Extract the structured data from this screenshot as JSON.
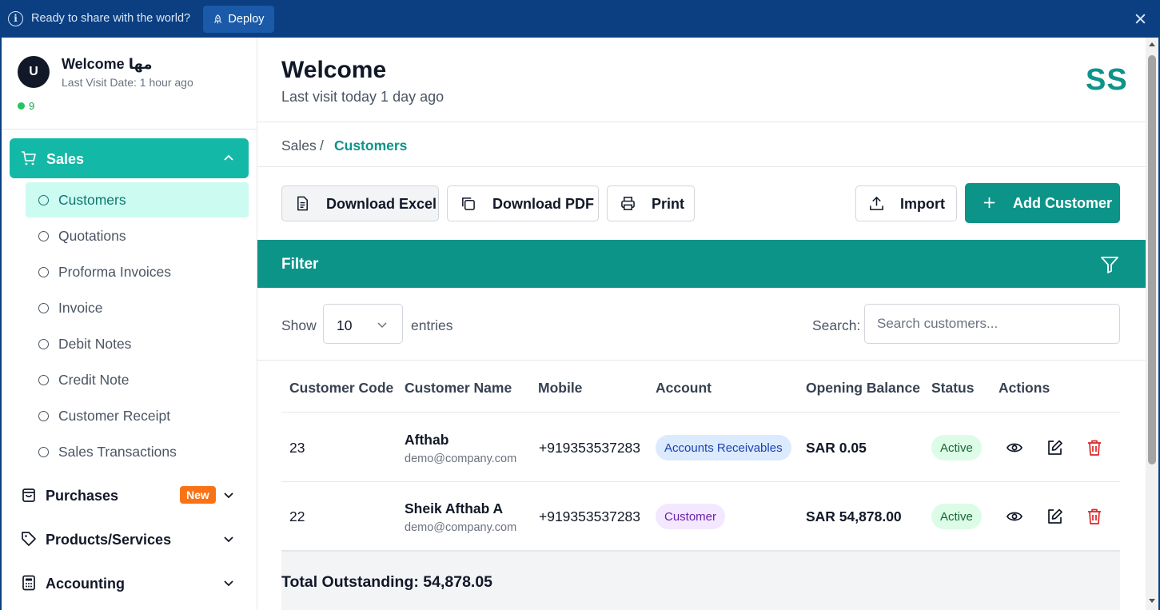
{
  "banner": {
    "message": "Ready to share with the world?",
    "deploy_label": "Deploy",
    "color": "#0b3f82"
  },
  "user": {
    "initial": "U",
    "welcome": "Welcome مها",
    "last_visit": "Last Visit Date: 1 hour ago",
    "online_count": "9"
  },
  "sidebar": {
    "sales_label": "Sales",
    "sales_items": [
      {
        "label": "Customers",
        "active": true
      },
      {
        "label": "Quotations"
      },
      {
        "label": "Proforma Invoices"
      },
      {
        "label": "Invoice"
      },
      {
        "label": "Debit Notes"
      },
      {
        "label": "Credit Note"
      },
      {
        "label": "Customer Receipt"
      },
      {
        "label": "Sales Transactions"
      }
    ],
    "groups": [
      {
        "label": "Purchases",
        "badge": "New",
        "icon": "shopping-bag-icon"
      },
      {
        "label": "Products/Services",
        "icon": "tag-icon"
      },
      {
        "label": "Accounting",
        "icon": "calculator-icon"
      }
    ]
  },
  "header": {
    "title": "Welcome",
    "subtitle": "Last visit today 1 day ago",
    "logo": "SS"
  },
  "breadcrumb": {
    "parent": "Sales",
    "separator": "/",
    "current": "Customers"
  },
  "toolbar": {
    "excel": "Download Excel",
    "pdf": "Download PDF",
    "print": "Print",
    "import": "Import",
    "add": "Add Customer"
  },
  "filter": {
    "title": "Filter"
  },
  "controls": {
    "show_label": "Show",
    "page_size": "10",
    "entries_label": "entries",
    "search_label": "Search:",
    "search_placeholder": "Search customers..."
  },
  "table": {
    "columns": [
      "Customer Code",
      "Customer Name",
      "Mobile",
      "Account",
      "Opening Balance",
      "Status",
      "Actions"
    ],
    "rows": [
      {
        "code": "23",
        "name": "Afthab",
        "email": "demo@company.com",
        "mobile": "+919353537283",
        "account": "Accounts Receivables",
        "balance": "SAR 0.05",
        "status": "Active"
      },
      {
        "code": "22",
        "name": "Sheik Afthab A",
        "email": "demo@company.com",
        "mobile": "+919353537283",
        "account": "Customer",
        "balance": "SAR 54,878.00",
        "status": "Active"
      }
    ]
  },
  "total": {
    "label": "Total Outstanding: 54,878.05"
  },
  "colors": {
    "accent": "#0d9488",
    "sidebar_active": "#14b8a6",
    "danger": "#dc2626"
  }
}
